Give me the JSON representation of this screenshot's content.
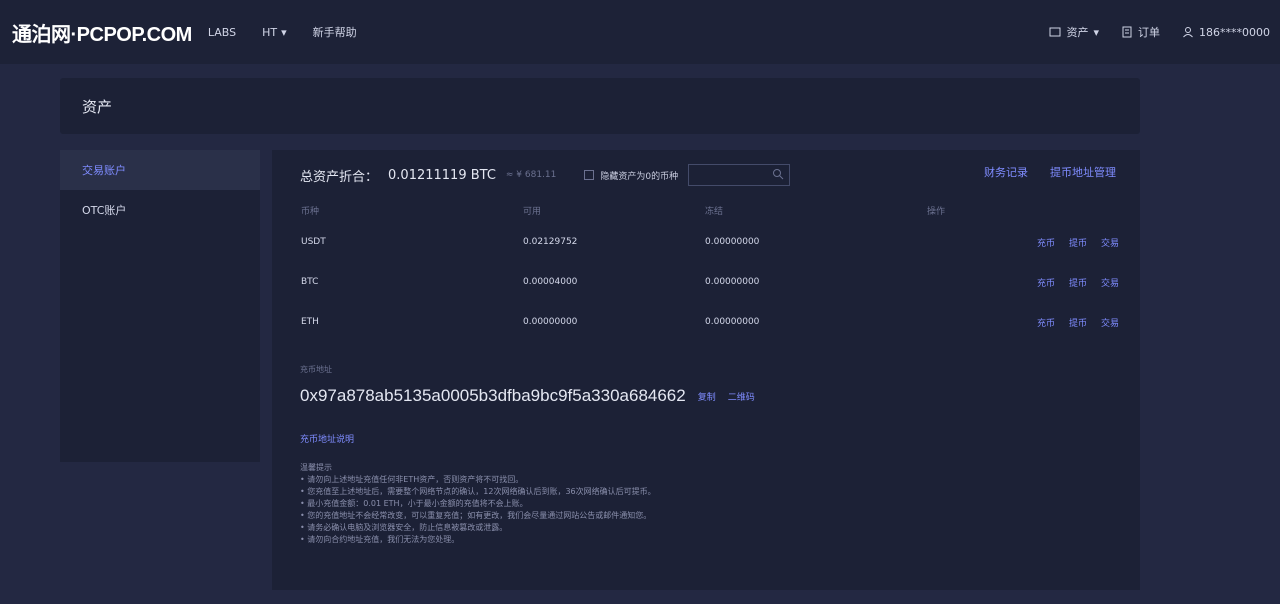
{
  "header": {
    "logo": "通泊网·PCPOP.COM",
    "nav": [
      {
        "label": "LABS"
      },
      {
        "label": "HT"
      },
      {
        "label": "新手帮助"
      }
    ],
    "right": [
      {
        "label": "资产",
        "icon": "wallet-icon"
      },
      {
        "label": "订单",
        "icon": "order-icon"
      },
      {
        "label": "186****0000",
        "icon": "user-icon"
      }
    ]
  },
  "page": {
    "title": "资产"
  },
  "sidebar": {
    "items": [
      {
        "label": "交易账户",
        "active": true
      },
      {
        "label": "OTC账户",
        "active": false
      }
    ]
  },
  "summary": {
    "label": "总资产折合：",
    "value": "0.01211119 BTC",
    "sub": "≈ ¥ 681.11",
    "hide_small": "隐藏资产为0的币种",
    "search_placeholder": "",
    "links": [
      "财务记录",
      "提币地址管理"
    ]
  },
  "table": {
    "headers": [
      "币种",
      "可用",
      "冻结",
      "操作"
    ],
    "rows": [
      {
        "coin": "USDT",
        "available": "0.02129752",
        "frozen": "0.00000000",
        "ops": [
          "充币",
          "提币",
          "交易"
        ]
      },
      {
        "coin": "BTC",
        "available": "0.00004000",
        "frozen": "0.00000000",
        "ops": [
          "充币",
          "提币",
          "交易"
        ]
      },
      {
        "coin": "ETH",
        "available": "0.00000000",
        "frozen": "0.00000000",
        "ops": [
          "充币",
          "提币",
          "交易"
        ]
      }
    ]
  },
  "deposit": {
    "label": "充币地址",
    "address": "0x97a878ab5135a0005b3dfba9bc9f5a330a684662",
    "copy": "复制",
    "qrcode": "二维码",
    "tip_title": "充币地址说明",
    "notes_title": "温馨提示",
    "notes": [
      "• 请勿向上述地址充值任何非ETH资产，否则资产将不可找回。",
      "• 您充值至上述地址后，需要整个网络节点的确认，12次网络确认后到账，36次网络确认后可提币。",
      "• 最小充值金额：0.01 ETH，小于最小金额的充值将不会上账。",
      "• 您的充值地址不会经常改变，可以重复充值；如有更改，我们会尽量通过网站公告或邮件通知您。",
      "• 请务必确认电脑及浏览器安全，防止信息被篡改或泄露。",
      "• 请勿向合约地址充值，我们无法为您处理。"
    ]
  }
}
